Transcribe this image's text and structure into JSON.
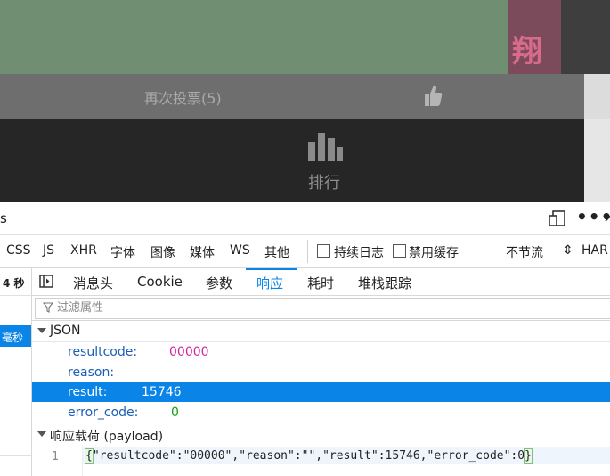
{
  "app": {
    "vote_button_label": "再次投票(5)",
    "rank_label": "排行",
    "partial_glyph": "翔"
  },
  "devtools": {
    "title_fragment": "s",
    "toolbar_icons": [
      "dock-side-icon",
      "more-options-icon",
      "close-icon"
    ],
    "more_glyph": "•••",
    "close_glyph": "×",
    "filter_types": [
      "CSS",
      "JS",
      "XHR",
      "字体",
      "图像",
      "媒体",
      "WS",
      "其他"
    ],
    "persist_logs_label": "持续日志",
    "disable_cache_label": "禁用缓存",
    "throttle_label": "不节流",
    "throttle_arrow": "⇕",
    "har_label": "HAR",
    "left_column_header": "4 秒",
    "left_selected_cell": "毫秒",
    "tabs": [
      "消息头",
      "Cookie",
      "参数",
      "响应",
      "耗时",
      "堆栈跟踪"
    ],
    "active_tab": "响应",
    "filter_placeholder": "过滤属性",
    "json_section_label": "JSON",
    "json_rows": [
      {
        "key": "resultcode:",
        "value": "00000",
        "color": "#d6249f"
      },
      {
        "key": "reason:",
        "value": "",
        "color": "#222222"
      },
      {
        "key": "result:",
        "value": "15746",
        "color": "#ffffff"
      },
      {
        "key": "error_code:",
        "value": "0",
        "color": "#12a012"
      }
    ],
    "selected_row": "result",
    "payload_section_label": "响应载荷 (payload)",
    "payload_line_number": "1",
    "payload_open_brace": "{",
    "payload_body": "\"resultcode\":\"00000\",\"reason\":\"\",\"result\":15746,\"error_code\":0",
    "payload_close_brace": "}"
  },
  "colors": {
    "accent": "#0a84e6",
    "app_dark_bar": "#262626",
    "app_vote_bar": "#6e6e6e"
  }
}
